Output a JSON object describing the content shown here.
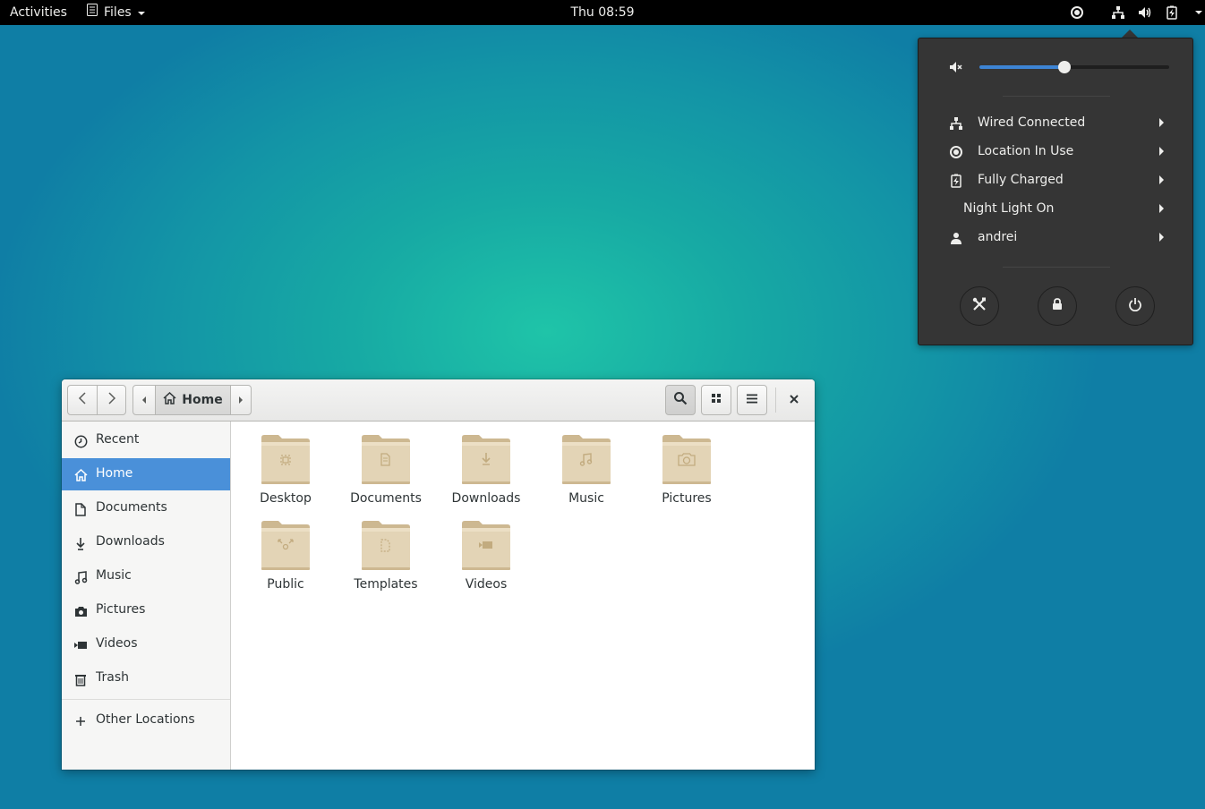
{
  "topbar": {
    "activities": "Activities",
    "app_menu_label": "Files",
    "clock": "Thu 08:59",
    "indicators": [
      "location-icon",
      "network-wired-icon",
      "volume-icon",
      "battery-icon",
      "dropdown-arrow-icon"
    ]
  },
  "system_menu": {
    "volume": {
      "level": 0.45,
      "icon": "volume-muted-icon"
    },
    "items": [
      {
        "label": "Wired Connected",
        "icon": "network-wired-icon"
      },
      {
        "label": "Location In Use",
        "icon": "location-icon"
      },
      {
        "label": "Fully Charged",
        "icon": "battery-charged-icon"
      },
      {
        "label": "Night Light On",
        "icon": ""
      },
      {
        "label": "andrei",
        "icon": "user-icon"
      }
    ],
    "buttons": [
      "settings-icon",
      "lock-icon",
      "power-icon"
    ]
  },
  "files": {
    "pathbar": {
      "current": "Home"
    },
    "sidebar": {
      "items": [
        {
          "label": "Recent",
          "icon": "clock-icon"
        },
        {
          "label": "Home",
          "icon": "home-icon",
          "active": true
        },
        {
          "label": "Documents",
          "icon": "document-icon"
        },
        {
          "label": "Downloads",
          "icon": "download-icon"
        },
        {
          "label": "Music",
          "icon": "music-icon"
        },
        {
          "label": "Pictures",
          "icon": "camera-icon"
        },
        {
          "label": "Videos",
          "icon": "video-icon"
        },
        {
          "label": "Trash",
          "icon": "trash-icon"
        }
      ],
      "other_locations": "Other Locations"
    },
    "folders": [
      {
        "label": "Desktop",
        "emblem": "desktop"
      },
      {
        "label": "Documents",
        "emblem": "documents"
      },
      {
        "label": "Downloads",
        "emblem": "downloads"
      },
      {
        "label": "Music",
        "emblem": "music"
      },
      {
        "label": "Pictures",
        "emblem": "pictures"
      },
      {
        "label": "Public",
        "emblem": "public"
      },
      {
        "label": "Templates",
        "emblem": "templates"
      },
      {
        "label": "Videos",
        "emblem": "videos"
      }
    ]
  },
  "colors": {
    "selection": "#4a90d9",
    "slider_fill": "#3d84d4",
    "popover_bg": "#353535",
    "folder": "#d9c7a3"
  }
}
